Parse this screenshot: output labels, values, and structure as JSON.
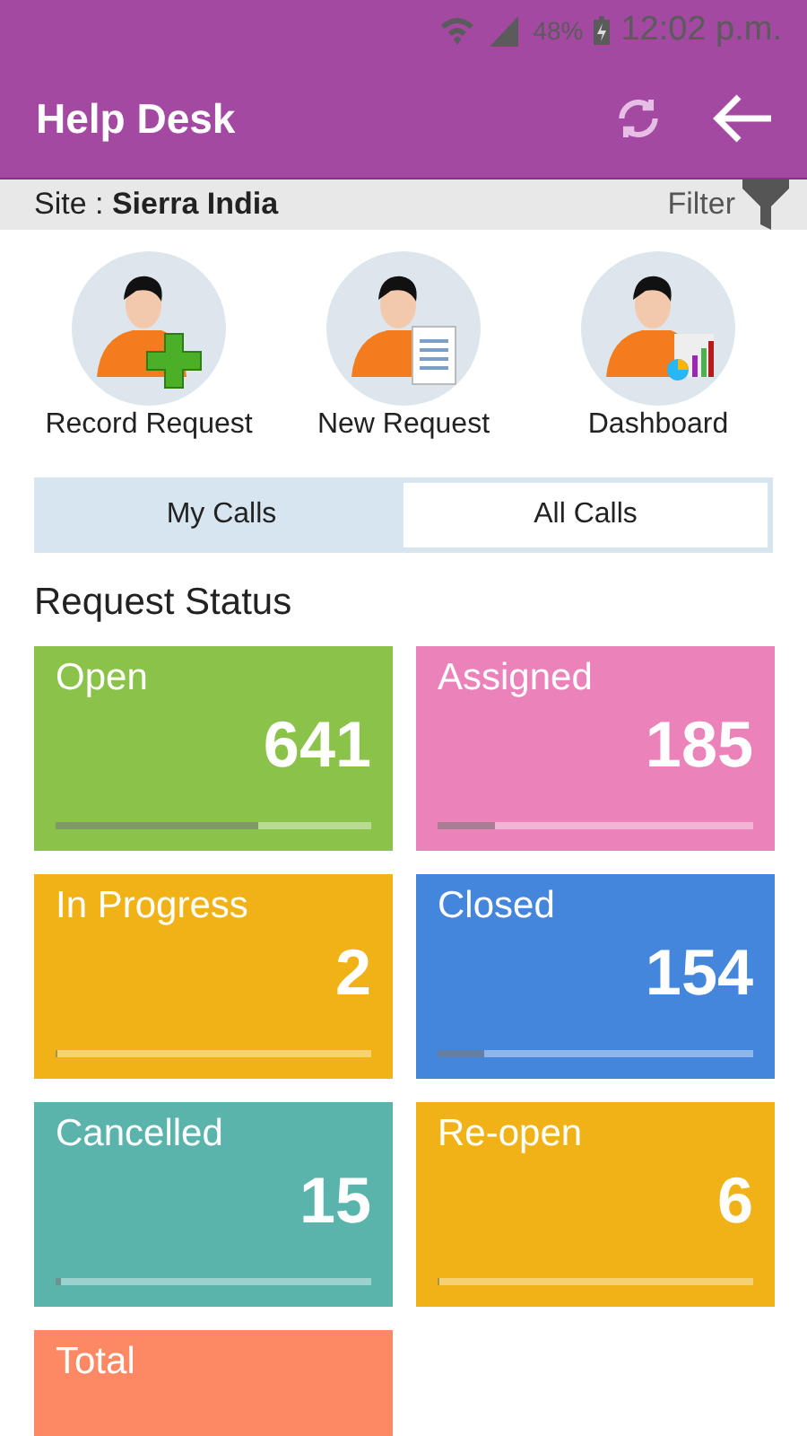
{
  "status_bar": {
    "battery": "48%",
    "time": "12:02 p.m."
  },
  "app_bar": {
    "title": "Help Desk"
  },
  "site_bar": {
    "label": "Site : ",
    "site": "Sierra India",
    "filter": "Filter"
  },
  "actions": [
    {
      "kind": "add",
      "label": "Record Request"
    },
    {
      "kind": "report",
      "label": "New Request"
    },
    {
      "kind": "chart",
      "label": "Dashboard"
    }
  ],
  "tabs": [
    {
      "label": "My Calls",
      "selected": true
    },
    {
      "label": "All Calls",
      "selected": false
    }
  ],
  "section_title": "Request Status",
  "cards": [
    {
      "label": "Open",
      "count": "641",
      "color": "#8bc34a",
      "level": 0.64
    },
    {
      "label": "Assigned",
      "count": "185",
      "color": "#eb82b9",
      "level": 0.18
    },
    {
      "label": "In Progress",
      "count": "2",
      "color": "#f0b217",
      "level": 0.005
    },
    {
      "label": "Closed",
      "count": "154",
      "color": "#4486dc",
      "level": 0.15
    },
    {
      "label": "Cancelled",
      "count": "15",
      "color": "#5ab4ac",
      "level": 0.015
    },
    {
      "label": "Re-open",
      "count": "6",
      "color": "#f0b217",
      "level": 0.005
    },
    {
      "label": "Total",
      "color": "#fd8964"
    }
  ]
}
